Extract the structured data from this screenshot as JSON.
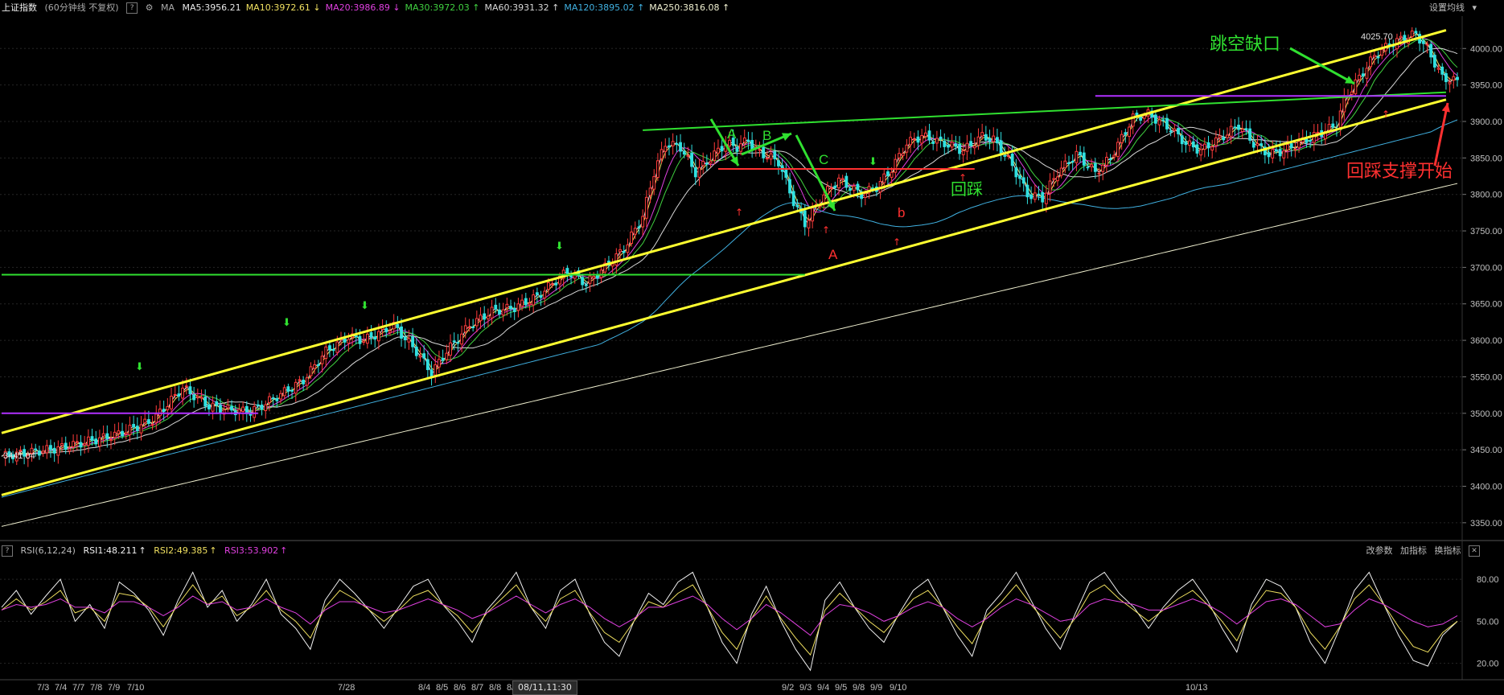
{
  "header": {
    "title": "上证指数",
    "subtitle": "(60分钟线 不复权)",
    "help": "?",
    "ma_label": "MA",
    "ma_items": [
      {
        "text": "MA5:3956.21",
        "color": "#e8e8e8",
        "arrow": ""
      },
      {
        "text": "MA10:3972.61",
        "color": "#f0e060",
        "arrow": "↓"
      },
      {
        "text": "MA20:3986.89",
        "color": "#e040e0",
        "arrow": "↓"
      },
      {
        "text": "MA30:3972.03",
        "color": "#40d040",
        "arrow": "↑"
      },
      {
        "text": "MA60:3931.32",
        "color": "#d8d8d8",
        "arrow": "↑"
      },
      {
        "text": "MA120:3895.02",
        "color": "#40b0e0",
        "arrow": "↑"
      },
      {
        "text": "MA250:3816.08",
        "color": "#f0f0d0",
        "arrow": "↑"
      }
    ],
    "settings_label": "设置均线"
  },
  "rsi_header": {
    "help": "?",
    "name": "RSI(6,12,24)",
    "rsi1": "RSI1:48.211",
    "rsi2": "RSI2:49.385",
    "rsi3": "RSI3:53.902",
    "btn_params": "改参数",
    "btn_add": "加指标",
    "btn_switch": "换指标",
    "close": "✕"
  },
  "annotations": {
    "gap": "跳空缺口",
    "pullback": "回踩",
    "support": "回踩支撑开始",
    "A_top": "A",
    "B_top": "B",
    "C_top": "C",
    "A_bottom": "A",
    "b_bottom": "b",
    "peak_label": "4025.70",
    "low_label": "3441.04"
  },
  "time_axis": {
    "labels": [
      "7/3",
      "7/4",
      "7/7",
      "7/8",
      "7/9",
      "7/10",
      "7/28",
      "8/4",
      "8/5",
      "8/6",
      "8/7",
      "8/8",
      "8/",
      "9/2",
      "9/3",
      "9/4",
      "9/5",
      "9/8",
      "9/9",
      "9/10",
      "10/13"
    ],
    "cursor": "08/11,11:30"
  },
  "colors": {
    "up": "#ff3b3b",
    "down": "#30e0e0",
    "channel": "#ffff30",
    "green_line": "#30e030",
    "purple_line": "#b030ff",
    "red_line": "#ff3030",
    "axis_text": "#c0c0c0",
    "grid": "#262626"
  },
  "chart_data": [
    {
      "type": "candlestick",
      "title": "上证指数",
      "yticks": [
        3350,
        3400,
        3450,
        3500,
        3550,
        3600,
        3650,
        3700,
        3750,
        3800,
        3850,
        3900,
        3950,
        4000
      ],
      "ylim": [
        3330,
        4040
      ],
      "grid": true,
      "close_path": [
        [
          0,
          3441
        ],
        [
          15,
          3452
        ],
        [
          30,
          3470
        ],
        [
          40,
          3490
        ],
        [
          48,
          3535
        ],
        [
          55,
          3510
        ],
        [
          60,
          3505
        ],
        [
          66,
          3502
        ],
        [
          72,
          3520
        ],
        [
          80,
          3545
        ],
        [
          86,
          3585
        ],
        [
          92,
          3605
        ],
        [
          96,
          3600
        ],
        [
          100,
          3610
        ],
        [
          104,
          3620
        ],
        [
          110,
          3585
        ],
        [
          114,
          3555
        ],
        [
          118,
          3585
        ],
        [
          124,
          3620
        ],
        [
          130,
          3640
        ],
        [
          136,
          3645
        ],
        [
          142,
          3660
        ],
        [
          150,
          3695
        ],
        [
          155,
          3678
        ],
        [
          160,
          3700
        ],
        [
          165,
          3725
        ],
        [
          170,
          3770
        ],
        [
          173,
          3830
        ],
        [
          176,
          3870
        ],
        [
          180,
          3865
        ],
        [
          184,
          3830
        ],
        [
          188,
          3850
        ],
        [
          192,
          3870
        ],
        [
          195,
          3865
        ],
        [
          198,
          3875
        ],
        [
          200,
          3860
        ],
        [
          206,
          3845
        ],
        [
          210,
          3790
        ],
        [
          213,
          3760
        ],
        [
          218,
          3800
        ],
        [
          222,
          3820
        ],
        [
          228,
          3800
        ],
        [
          232,
          3810
        ],
        [
          236,
          3835
        ],
        [
          240,
          3870
        ],
        [
          244,
          3880
        ],
        [
          250,
          3870
        ],
        [
          255,
          3860
        ],
        [
          260,
          3880
        ],
        [
          263,
          3875
        ],
        [
          268,
          3840
        ],
        [
          272,
          3800
        ],
        [
          276,
          3795
        ],
        [
          280,
          3830
        ],
        [
          285,
          3855
        ],
        [
          290,
          3830
        ],
        [
          294,
          3850
        ],
        [
          300,
          3905
        ],
        [
          304,
          3910
        ],
        [
          310,
          3890
        ],
        [
          314,
          3870
        ],
        [
          318,
          3860
        ],
        [
          324,
          3880
        ],
        [
          328,
          3895
        ],
        [
          332,
          3870
        ],
        [
          336,
          3855
        ],
        [
          340,
          3860
        ],
        [
          346,
          3875
        ],
        [
          350,
          3885
        ],
        [
          354,
          3895
        ],
        [
          356,
          3930
        ],
        [
          360,
          3960
        ],
        [
          364,
          3990
        ],
        [
          368,
          4005
        ],
        [
          372,
          4015
        ],
        [
          375,
          4020
        ],
        [
          378,
          4000
        ],
        [
          382,
          3960
        ],
        [
          386,
          3955
        ]
      ],
      "overlays": [
        {
          "name": "MA5",
          "color": "#e8e8e8"
        },
        {
          "name": "MA10",
          "color": "#f0e060"
        },
        {
          "name": "MA20",
          "color": "#e040e0"
        },
        {
          "name": "MA30",
          "color": "#40d040"
        },
        {
          "name": "MA60",
          "color": "#d8d8d8"
        },
        {
          "name": "MA120",
          "color": "#40b0e0"
        },
        {
          "name": "MA250",
          "color": "#f0f0d0"
        }
      ],
      "trendlines": [
        {
          "name": "upper-channel",
          "color": "#ffff30",
          "from": [
            0,
            3473
          ],
          "to": [
            383,
            4025
          ]
        },
        {
          "name": "lower-channel",
          "color": "#ffff30",
          "from": [
            0,
            3388
          ],
          "to": [
            383,
            3930
          ]
        },
        {
          "name": "green-resistance",
          "color": "#30e030",
          "from": [
            170,
            3888
          ],
          "to": [
            383,
            3940
          ]
        },
        {
          "name": "green-horizontal",
          "color": "#30e030",
          "from": [
            0,
            3690
          ],
          "to": [
            213,
            3690
          ]
        },
        {
          "name": "purple-upper",
          "color": "#b030ff",
          "from": [
            290,
            3935
          ],
          "to": [
            383,
            3935
          ]
        },
        {
          "name": "purple-lower",
          "color": "#b030ff",
          "from": [
            0,
            3500
          ],
          "to": [
            68,
            3500
          ]
        },
        {
          "name": "red-support",
          "color": "#ff3030",
          "from": [
            190,
            3835
          ],
          "to": [
            258,
            3835
          ]
        }
      ]
    },
    {
      "type": "line",
      "title": "RSI(6,12,24)",
      "yticks": [
        20,
        50,
        80
      ],
      "ylim": [
        10,
        95
      ],
      "series": [
        {
          "name": "RSI1",
          "color": "#f0f0f0",
          "values": [
            60,
            72,
            55,
            68,
            80,
            50,
            62,
            45,
            78,
            70,
            58,
            40,
            65,
            85,
            60,
            72,
            50,
            62,
            80,
            55,
            45,
            30,
            65,
            80,
            70,
            58,
            45,
            60,
            75,
            80,
            62,
            50,
            35,
            58,
            70,
            85,
            60,
            45,
            72,
            80,
            55,
            35,
            25,
            50,
            70,
            62,
            78,
            85,
            60,
            35,
            20,
            55,
            75,
            50,
            30,
            15,
            65,
            78,
            60,
            45,
            35,
            55,
            72,
            80,
            60,
            40,
            25,
            58,
            70,
            85,
            65,
            45,
            30,
            55,
            78,
            85,
            70,
            60,
            45,
            60,
            72,
            80,
            65,
            45,
            28,
            62,
            80,
            75,
            60,
            35,
            20,
            45,
            72,
            85,
            62,
            40,
            22,
            18,
            40,
            50
          ]
        },
        {
          "name": "RSI2",
          "color": "#f0e060",
          "values": [
            58,
            66,
            58,
            64,
            72,
            56,
            60,
            50,
            70,
            68,
            60,
            46,
            62,
            76,
            62,
            68,
            54,
            60,
            72,
            58,
            50,
            38,
            60,
            72,
            66,
            58,
            50,
            58,
            68,
            72,
            62,
            54,
            42,
            56,
            66,
            76,
            60,
            50,
            66,
            72,
            56,
            42,
            35,
            50,
            64,
            60,
            70,
            76,
            60,
            42,
            30,
            52,
            68,
            52,
            38,
            26,
            58,
            70,
            60,
            50,
            42,
            54,
            66,
            72,
            60,
            46,
            34,
            54,
            64,
            76,
            62,
            50,
            38,
            52,
            70,
            76,
            66,
            58,
            50,
            58,
            66,
            72,
            62,
            50,
            36,
            58,
            72,
            70,
            60,
            42,
            30,
            46,
            66,
            76,
            62,
            46,
            32,
            28,
            42,
            50
          ]
        },
        {
          "name": "RSI3",
          "color": "#e040e0",
          "values": [
            58,
            62,
            60,
            62,
            66,
            60,
            60,
            56,
            64,
            64,
            60,
            54,
            60,
            68,
            62,
            64,
            58,
            60,
            66,
            60,
            56,
            48,
            58,
            64,
            64,
            60,
            56,
            58,
            62,
            66,
            62,
            58,
            52,
            56,
            62,
            68,
            62,
            56,
            62,
            66,
            60,
            52,
            46,
            52,
            60,
            60,
            64,
            68,
            62,
            52,
            44,
            52,
            62,
            56,
            48,
            40,
            54,
            62,
            60,
            56,
            50,
            54,
            60,
            64,
            60,
            52,
            46,
            52,
            60,
            66,
            62,
            56,
            50,
            52,
            62,
            66,
            64,
            62,
            58,
            58,
            62,
            66,
            62,
            56,
            48,
            56,
            64,
            66,
            62,
            54,
            46,
            48,
            58,
            66,
            62,
            56,
            50,
            46,
            48,
            54
          ]
        }
      ]
    }
  ]
}
